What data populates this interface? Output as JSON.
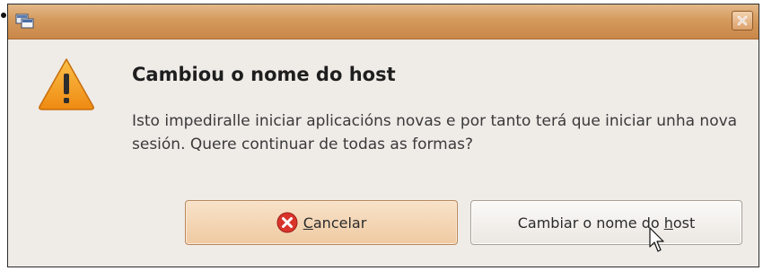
{
  "dialog": {
    "heading": "Cambiou o nome do host",
    "message": "Isto impediralle iniciar aplicacións novas e por tanto terá que iniciar unha nova sesión. Quere continuar de todas as formas?"
  },
  "buttons": {
    "cancel": {
      "mnemonic": "C",
      "rest": "ancelar"
    },
    "rename": {
      "before": "Cambiar o nome do ",
      "mnemonic": "h",
      "after": "ost"
    }
  },
  "icons": {
    "window": "window-app-icon",
    "close": "close-icon",
    "warning": "warning-icon",
    "cancel": "cancel-icon",
    "cursor": "mouse-cursor"
  },
  "colors": {
    "titlebar": "#d49a5c",
    "dialog_bg": "#efebe7",
    "warning_fill": "#f19b1d",
    "cancel_icon": "#d9342b"
  }
}
